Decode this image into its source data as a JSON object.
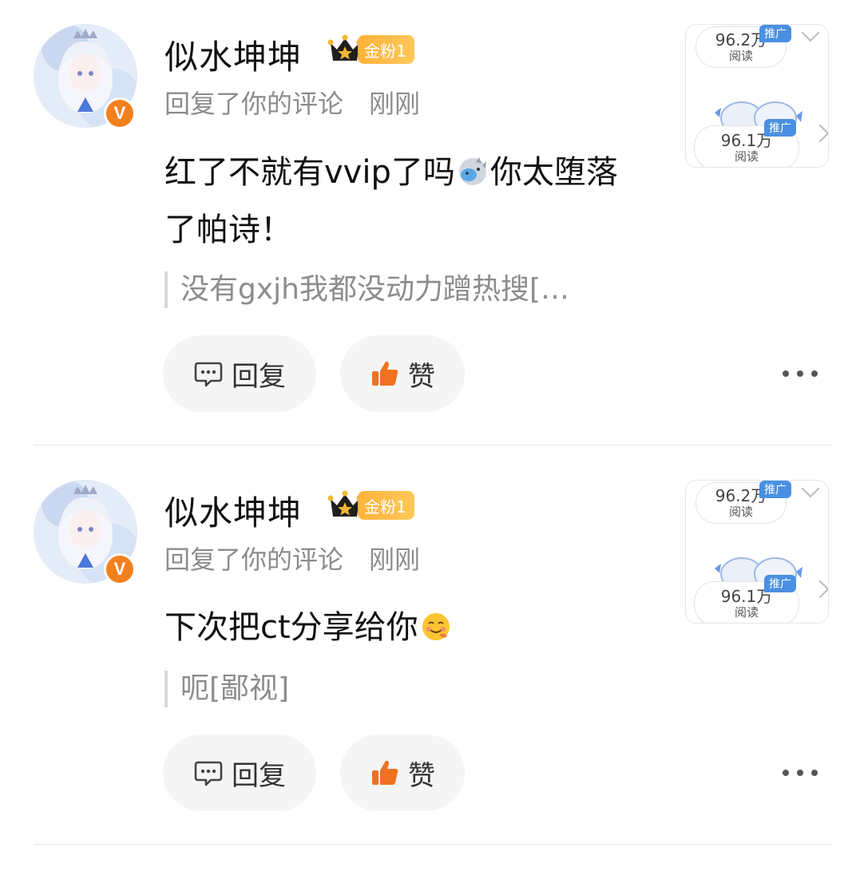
{
  "comments": [
    {
      "username": "似水坤坤",
      "fan_badge": "金粉1",
      "action": "回复了你的评论",
      "time": "刚刚",
      "verified_mark": "V",
      "text_before_emoji": "红了不就有vvip了吗",
      "emoji": "bird-cat-emoji",
      "text_after_emoji": "你太堕落了帕诗！",
      "quote": "没有gxjh我都没动力蹭热搜[…",
      "reply_label": "回复",
      "like_label": "赞",
      "thumb": {
        "top_count": "96.2万",
        "top_label": "阅读",
        "top_tag": "推广",
        "bottom_count": "96.1万",
        "bottom_label": "阅读",
        "bottom_tag": "推广"
      }
    },
    {
      "username": "似水坤坤",
      "fan_badge": "金粉1",
      "action": "回复了你的评论",
      "time": "刚刚",
      "verified_mark": "V",
      "text_before_emoji": "下次把ct分享给你",
      "emoji": "smiling-face-emoji",
      "text_after_emoji": "",
      "quote": "呃[鄙视]",
      "reply_label": "回复",
      "like_label": "赞",
      "thumb": {
        "top_count": "96.2万",
        "top_label": "阅读",
        "top_tag": "推广",
        "bottom_count": "96.1万",
        "bottom_label": "阅读",
        "bottom_tag": "推广"
      }
    }
  ],
  "colors": {
    "accent_orange": "#f2811d",
    "badge_gold": "#ffb23b",
    "like_icon": "#f0711f",
    "gray_text": "#8c8c8c"
  }
}
